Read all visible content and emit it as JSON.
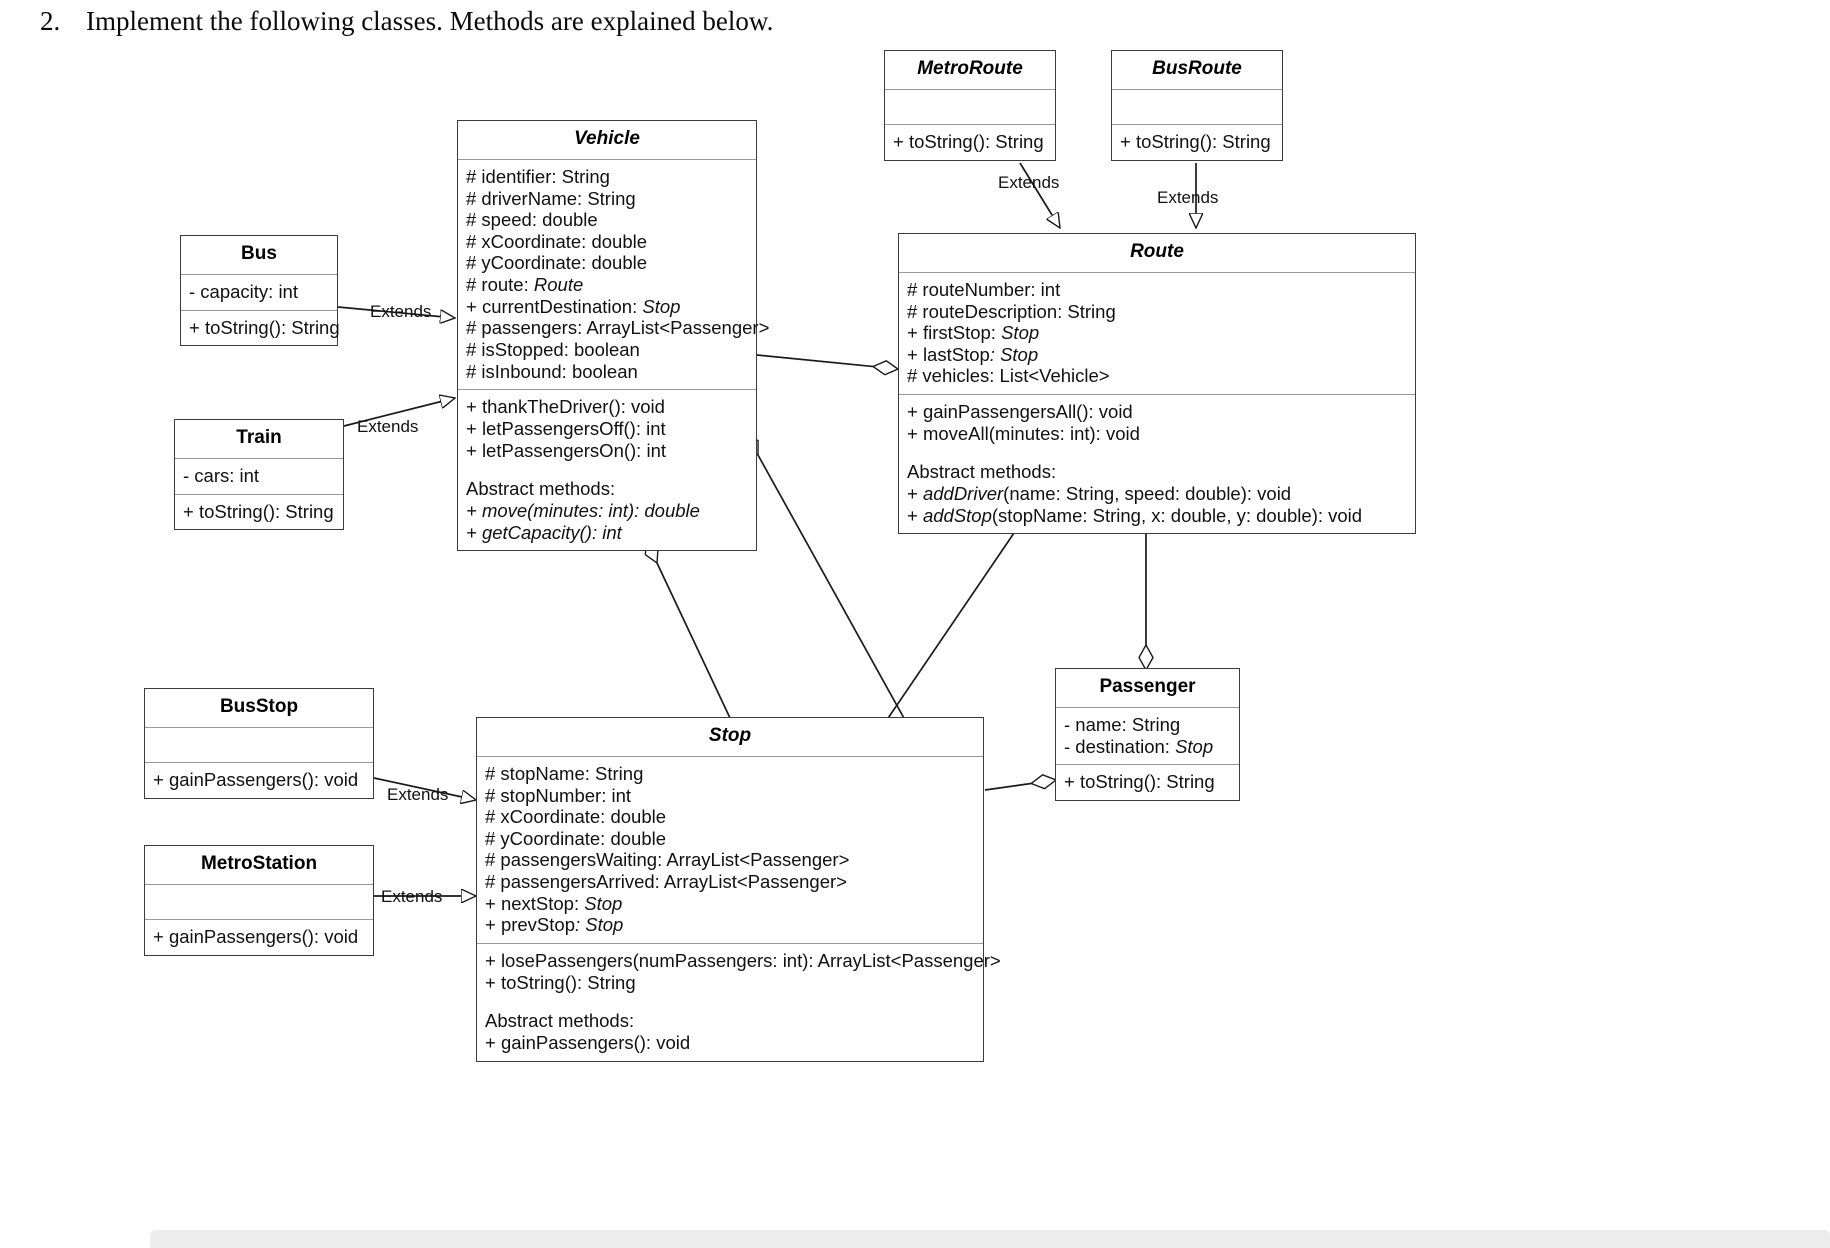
{
  "heading": {
    "number": "2.",
    "text": "Implement the following classes. Methods are explained below."
  },
  "labels": {
    "extends": "Extends"
  },
  "classes": {
    "metro_route": {
      "name": "MetroRoute",
      "abstract": true,
      "attributes": [],
      "methods": [
        "+ toString(): String"
      ]
    },
    "bus_route": {
      "name": "BusRoute",
      "abstract": true,
      "attributes": [],
      "methods": [
        "+ toString(): String"
      ]
    },
    "vehicle": {
      "name": "Vehicle",
      "abstract": true,
      "attributes": [
        "# identifier: String",
        "# driverName: String",
        "# speed: double",
        "# xCoordinate: double",
        "# yCoordinate: double",
        "# route: Route",
        "+ currentDestination: Stop",
        "# passengers: ArrayList<Passenger>",
        "# isStopped: boolean",
        "# isInbound: boolean"
      ],
      "methods": [
        "+ thankTheDriver(): void",
        "+ letPassengersOff(): int",
        "+ letPassengersOn(): int"
      ],
      "abstract_header": "Abstract methods:",
      "abstract_methods": [
        "+ move(minutes: int): double",
        "+ getCapacity(): int"
      ]
    },
    "route": {
      "name": "Route",
      "abstract": true,
      "attributes": [
        "# routeNumber: int",
        "# routeDescription: String",
        "+ firstStop: Stop",
        "+ lastStop: Stop",
        "# vehicles: List<Vehicle>"
      ],
      "methods": [
        "+ gainPassengersAll(): void",
        "+ moveAll(minutes: int): void"
      ],
      "abstract_header": "Abstract methods:",
      "abstract_methods": [
        "+ addDriver(name: String, speed: double): void",
        "+ addStop(stopName: String, x: double, y: double): void"
      ]
    },
    "bus": {
      "name": "Bus",
      "abstract": false,
      "attributes": [
        "- capacity: int"
      ],
      "methods": [
        "+ toString(): String"
      ]
    },
    "train": {
      "name": "Train",
      "abstract": false,
      "attributes": [
        "- cars: int"
      ],
      "methods": [
        "+ toString(): String"
      ]
    },
    "bus_stop": {
      "name": "BusStop",
      "abstract": false,
      "attributes": [],
      "methods": [
        "+ gainPassengers(): void"
      ]
    },
    "metro_station": {
      "name": "MetroStation",
      "abstract": false,
      "attributes": [],
      "methods": [
        "+ gainPassengers(): void"
      ]
    },
    "stop": {
      "name": "Stop",
      "abstract": true,
      "attributes": [
        "# stopName: String",
        "# stopNumber: int",
        "# xCoordinate: double",
        "# yCoordinate: double",
        "# passengersWaiting: ArrayList<Passenger>",
        "# passengersArrived: ArrayList<Passenger>",
        "+ nextStop: Stop",
        "+ prevStop: Stop"
      ],
      "methods": [
        "+ losePassengers(numPassengers: int): ArrayList<Passenger>",
        "+ toString(): String"
      ],
      "abstract_header": "Abstract methods:",
      "abstract_methods": [
        "+ gainPassengers(): void"
      ]
    },
    "passenger": {
      "name": "Passenger",
      "abstract": false,
      "attributes": [
        "- name: String",
        "- destination: Stop"
      ],
      "methods": [
        "+ toString(): String"
      ]
    }
  },
  "relationships": [
    {
      "from": "MetroRoute",
      "to": "Route",
      "label": "Extends",
      "type": "generalization"
    },
    {
      "from": "BusRoute",
      "to": "Route",
      "label": "Extends",
      "type": "generalization"
    },
    {
      "from": "Bus",
      "to": "Vehicle",
      "label": "Extends",
      "type": "generalization"
    },
    {
      "from": "Train",
      "to": "Vehicle",
      "label": "Extends",
      "type": "generalization"
    },
    {
      "from": "BusStop",
      "to": "Stop",
      "label": "Extends",
      "type": "generalization"
    },
    {
      "from": "MetroStation",
      "to": "Stop",
      "label": "Extends",
      "type": "generalization"
    },
    {
      "from": "Route",
      "to": "Vehicle",
      "label": "",
      "type": "aggregation"
    },
    {
      "from": "Route",
      "to": "Stop",
      "label": "",
      "type": "composition"
    },
    {
      "from": "Route",
      "to": "Passenger",
      "label": "",
      "type": "aggregation"
    },
    {
      "from": "Vehicle",
      "to": "Stop",
      "label": "",
      "type": "aggregation"
    },
    {
      "from": "Stop",
      "to": "Passenger",
      "label": "",
      "type": "aggregation"
    }
  ]
}
